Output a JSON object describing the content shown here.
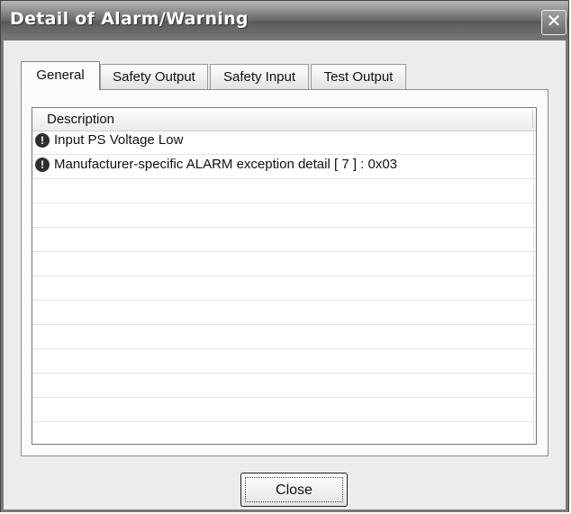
{
  "window": {
    "title": "Detail of Alarm/Warning",
    "close_glyph": "✕"
  },
  "tabs": [
    {
      "label": "General",
      "active": true
    },
    {
      "label": "Safety Output",
      "active": false
    },
    {
      "label": "Safety Input",
      "active": false
    },
    {
      "label": "Test Output",
      "active": false
    }
  ],
  "list": {
    "column_header": "Description",
    "items": [
      {
        "icon": "alarm-icon",
        "icon_glyph": "!",
        "text": "Input PS Voltage Low"
      },
      {
        "icon": "alarm-icon",
        "icon_glyph": "!",
        "text": "Manufacturer-specific ALARM exception detail [ 7 ] : 0x03"
      }
    ]
  },
  "footer": {
    "close_label": "Close"
  }
}
